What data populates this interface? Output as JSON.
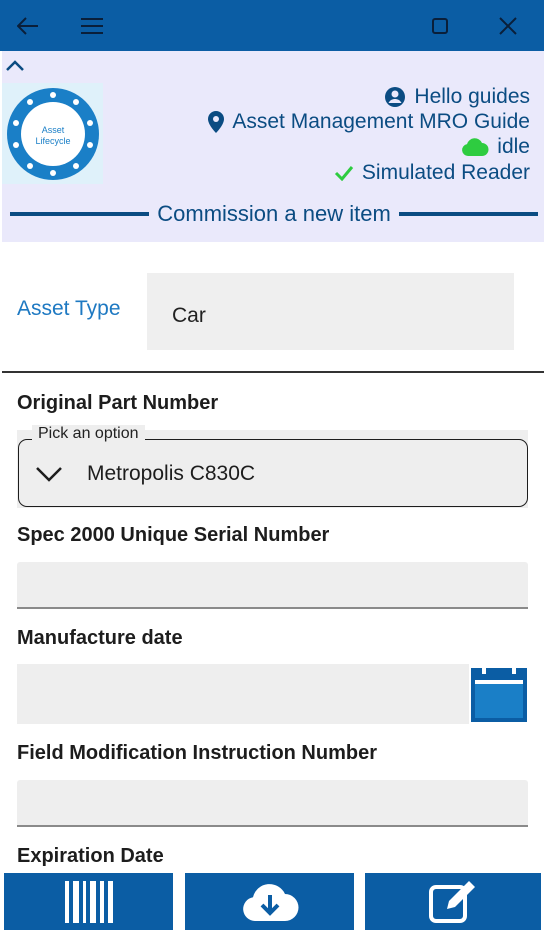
{
  "titlebar": {
    "back_icon": "arrow-left-icon",
    "menu_icon": "hamburger-menu-icon",
    "maximize_icon": "maximize-icon",
    "close_icon": "close-icon"
  },
  "header": {
    "collapse_icon": "chevron-up-icon",
    "logo": {
      "line1": "Asset",
      "line2": "Lifecycle"
    },
    "greeting": "Hello guides",
    "guide_name": "Asset Management MRO Guide",
    "status": "idle",
    "reader": "Simulated Reader",
    "section_title": "Commission a new item",
    "colors": {
      "accent": "#0b4c82",
      "status_cloud": "#2ecc40",
      "check": "#2ecc40"
    }
  },
  "asset": {
    "label": "Asset Type",
    "value": "Car"
  },
  "form": {
    "part_number_label": "Original Part Number",
    "part_number_picker_title": "Pick an option",
    "part_number_value": "Metropolis C830C",
    "serial_label": "Spec 2000 Unique Serial Number",
    "serial_value": "",
    "manufacture_date_label": "Manufacture date",
    "manufacture_date_value": "",
    "fmi_label": "Field Modification Instruction Number",
    "fmi_value": "",
    "expiration_label": "Expiration Date"
  },
  "toolbar": {
    "scan_icon": "barcode-icon",
    "download_icon": "cloud-download-icon",
    "edit_icon": "edit-icon"
  }
}
